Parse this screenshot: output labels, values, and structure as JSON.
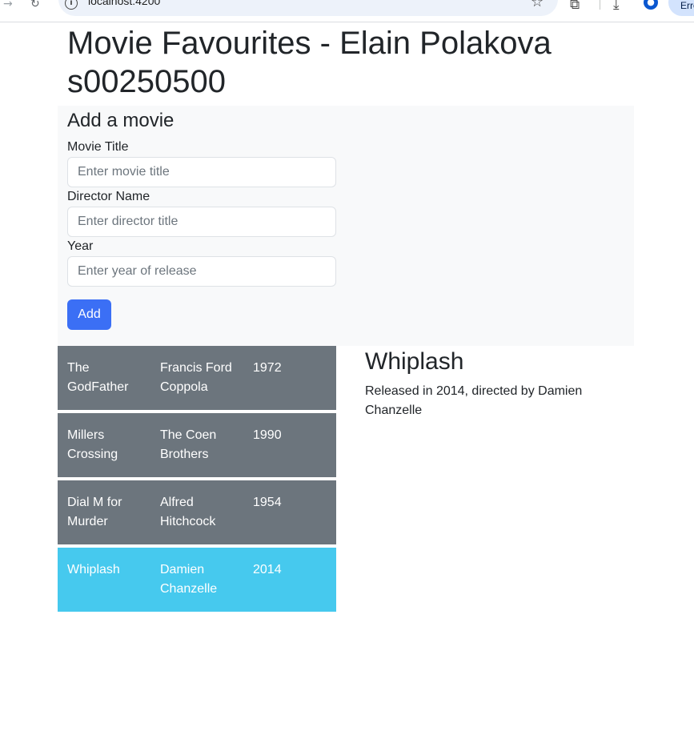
{
  "browser": {
    "url": "localhost:4200",
    "profile_pill": "Error"
  },
  "page": {
    "title": "Movie Favourites - Elain Polakova s00250500"
  },
  "form": {
    "heading": "Add a movie",
    "title_label": "Movie Title",
    "title_placeholder": "Enter movie title",
    "director_label": "Director Name",
    "director_placeholder": "Enter director title",
    "year_label": "Year",
    "year_placeholder": "Enter year of release",
    "add_label": "Add"
  },
  "movies": [
    {
      "title": "The GodFather",
      "director": "Francis Ford Coppola",
      "year": "1972"
    },
    {
      "title": "Millers Crossing",
      "director": "The Coen Brothers",
      "year": "1990"
    },
    {
      "title": "Dial M for Murder",
      "director": "Alfred Hitchcock",
      "year": "1954"
    },
    {
      "title": "Whiplash",
      "director": "Damien Chanzelle",
      "year": "2014"
    }
  ],
  "selected": {
    "title": "Whiplash",
    "description": "Released in 2014, directed by Damien Chanzelle"
  },
  "colors": {
    "row_default": "#6c757d",
    "row_selected": "#46c9ee",
    "button_primary": "#3b6ff5",
    "panel_bg": "#f8f9fa"
  }
}
